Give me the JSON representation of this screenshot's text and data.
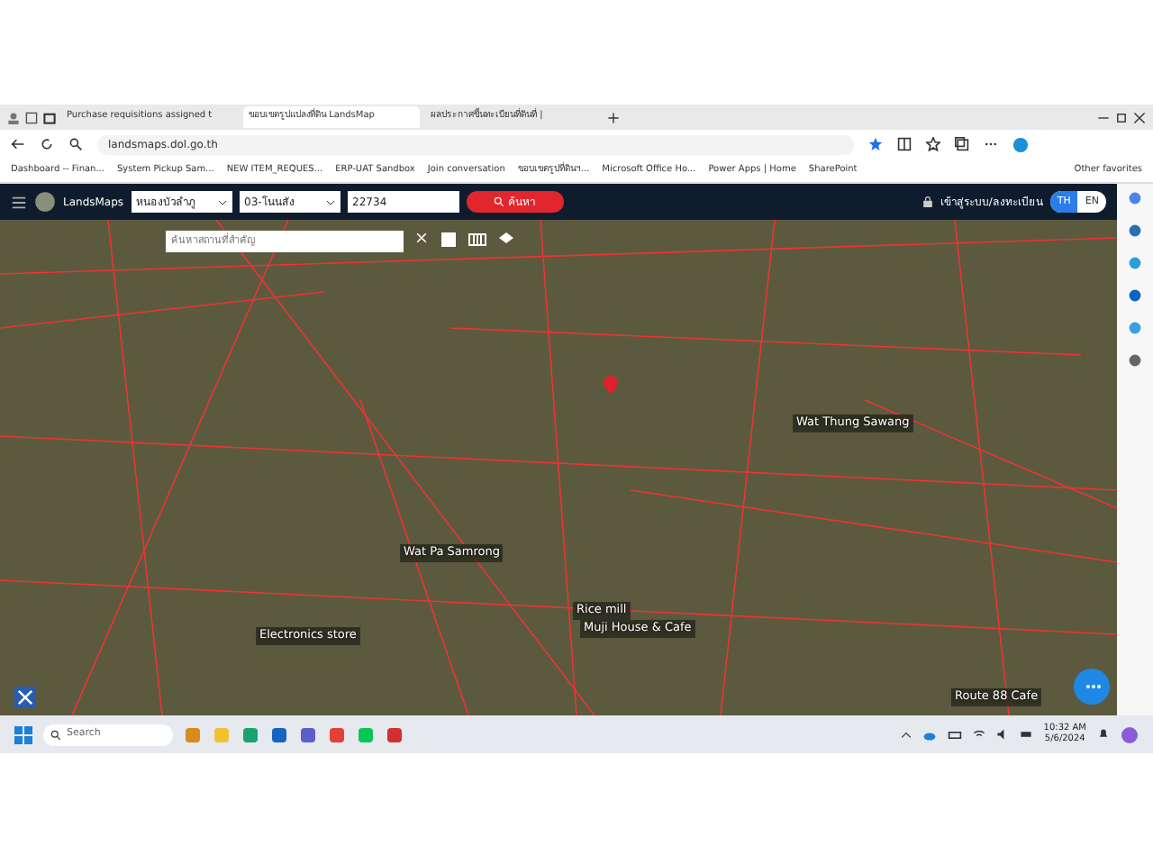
{
  "browser": {
    "tabs": [
      {
        "title": "Purchase requisitions assigned t",
        "selected": false
      },
      {
        "title": "ขอบเขตรูปแปลงที่ดิน LandsMap",
        "selected": true
      },
      {
        "title": "ผลประกาศขึ้นทะเบียนที่ดินที่ |",
        "selected": false
      }
    ],
    "address": "landsmaps.dol.go.th",
    "bookmarks": [
      "Dashboard -- Finan...",
      "System Pickup Sam...",
      "NEW ITEM_REQUES...",
      "ERP-UAT Sandbox",
      "Join conversation",
      "ขอบเขตรูปที่ดินฯ...",
      "Microsoft Office Ho...",
      "Power Apps | Home",
      "SharePoint"
    ],
    "other_favorites": "Other favorites"
  },
  "app": {
    "brand": "LandsMaps",
    "province": "หนองบัวลำภู",
    "district": "03-โนนสัง",
    "parcel": "22734",
    "search_button": "ค้นหา",
    "login": "เข้าสู่ระบบ/ลงทะเบียน",
    "languages": [
      {
        "label": "TH",
        "selected": true
      },
      {
        "label": "EN",
        "selected": false
      }
    ],
    "place_search": {
      "placeholder": "ค้นหาสถานที่สำคัญ"
    }
  },
  "map": {
    "labels": [
      "Wat Thung Sawang",
      "Wat Pa Samrong",
      "Rice mill",
      "Muji House & Cafe",
      "Electronics store",
      "Route 88 Cafe"
    ]
  },
  "taskbar": {
    "search_placeholder": "Search",
    "time": "10:32 AM",
    "date": "5/6/2024"
  }
}
